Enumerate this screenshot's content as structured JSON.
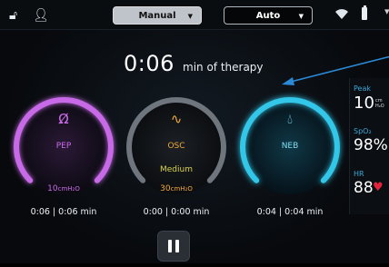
{
  "header": {
    "mode_selector": {
      "value": "Manual"
    },
    "auto_selector": {
      "value": "Auto"
    }
  },
  "therapy": {
    "elapsed": "0:06",
    "elapsed_suffix": "min of therapy"
  },
  "dials": [
    {
      "name": "PEP",
      "color": "#c86be8",
      "setting_value": "10",
      "setting_unit": "cmH₂O",
      "time": "0:06 | 0:06 min",
      "icon": "lungs-icon"
    },
    {
      "name": "OSC",
      "color": "#8a8f96",
      "accent": "#f0a83a",
      "intensity": "Medium",
      "setting_value": "30",
      "setting_unit": "cmH₂O",
      "time": "0:00 | 0:00 min",
      "icon": "wave-icon"
    },
    {
      "name": "NEB",
      "color": "#33c6e8",
      "time": "0:04 | 0:04 min",
      "icon": "droplet-icon"
    }
  ],
  "vitals": {
    "peak": {
      "label": "Peak",
      "value": "10",
      "unit_top": "cm",
      "unit_bottom": "H₂O"
    },
    "spo2": {
      "label": "SpO₂",
      "value": "98%"
    },
    "hr": {
      "label": "HR",
      "value": "88"
    }
  },
  "colors": {
    "pep": "#c86be8",
    "osc": "#8a8f96",
    "osc_accent": "#f0a83a",
    "neb": "#33c6e8",
    "vital_label": "#3aa8d8",
    "heart": "#e2233b"
  }
}
